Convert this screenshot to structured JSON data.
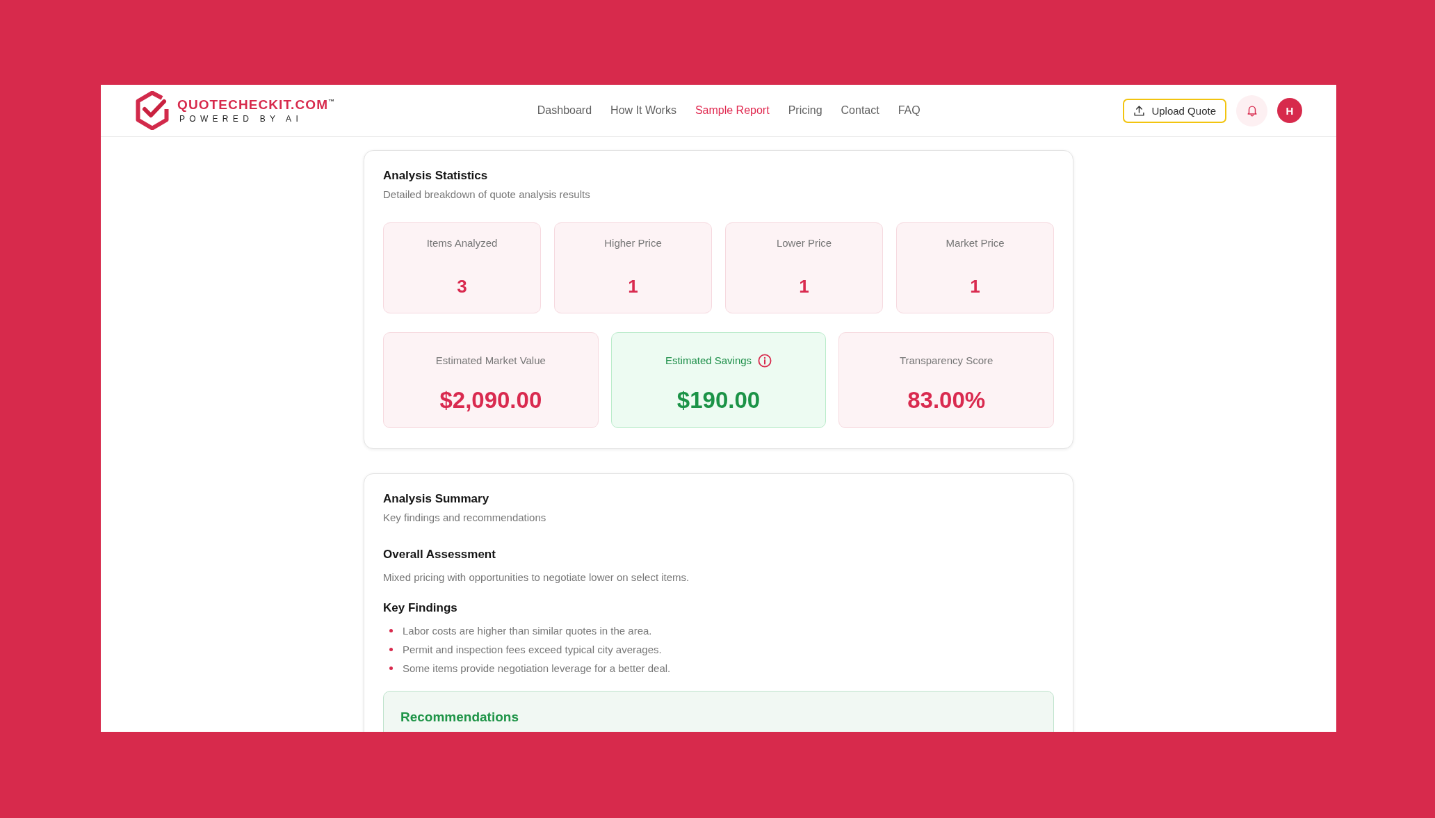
{
  "header": {
    "brand": {
      "name": "QUOTECHECKIT.COM$^{™}$",
      "tagline": "POWERED BY AI"
    },
    "nav": [
      {
        "label": "Dashboard",
        "selected": false
      },
      {
        "label": "How It Works",
        "selected": false
      },
      {
        "label": "Sample Report",
        "selected": true
      },
      {
        "label": "Pricing",
        "selected": false
      },
      {
        "label": "Contact",
        "selected": false
      },
      {
        "label": "FAQ",
        "selected": false
      }
    ],
    "upload_button": {
      "label": "Upload Quote"
    },
    "avatar": {
      "initial": "H"
    }
  },
  "statistics": {
    "title": "Analysis Statistics",
    "subtitle": "Detailed breakdown of quote analysis results",
    "counts": [
      {
        "label": "Items Analyzed",
        "value": "3"
      },
      {
        "label": "Higher Price",
        "value": "1"
      },
      {
        "label": "Lower Price",
        "value": "1"
      },
      {
        "label": "Market Price",
        "value": "1"
      }
    ],
    "totals": [
      {
        "label": "Estimated Market Value",
        "value": "$2,090.00",
        "kind": "neutral",
        "info": false
      },
      {
        "label": "Estimated Savings",
        "value": "$190.00",
        "kind": "savings",
        "info": true
      },
      {
        "label": "Transparency Score",
        "value": "83.00%",
        "kind": "neutral",
        "info": false
      }
    ]
  },
  "summary": {
    "title": "Analysis Summary",
    "subtitle": "Key findings and recommendations",
    "assessment_heading": "Overall Assessment",
    "assessment": "Mixed pricing with opportunities to negotiate lower on select items.",
    "findings_heading": "Key Findings",
    "findings": [
      "Labor costs are higher than similar quotes in the area.",
      "Permit and inspection fees exceed typical city averages.",
      "Some items provide negotiation leverage for a better deal."
    ],
    "recommendations": {
      "title": "Recommendations"
    }
  }
}
